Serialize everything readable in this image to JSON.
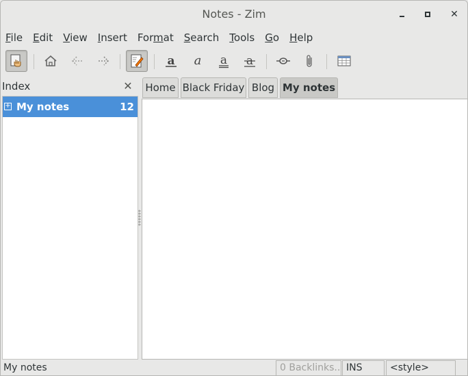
{
  "window": {
    "title": "Notes - Zim"
  },
  "menubar": {
    "items": [
      {
        "label": "File",
        "ul": "F",
        "rest": "ile"
      },
      {
        "label": "Edit",
        "ul": "E",
        "rest": "dit"
      },
      {
        "label": "View",
        "ul": "V",
        "rest": "iew"
      },
      {
        "label": "Insert",
        "ul": "I",
        "rest": "nsert"
      },
      {
        "label": "Format",
        "pre": "For",
        "ul": "m",
        "rest": "at"
      },
      {
        "label": "Search",
        "ul": "S",
        "rest": "earch"
      },
      {
        "label": "Tools",
        "ul": "T",
        "rest": "ools"
      },
      {
        "label": "Go",
        "ul": "G",
        "rest": "o"
      },
      {
        "label": "Help",
        "ul": "H",
        "rest": "elp"
      }
    ]
  },
  "toolbar": {
    "icons": [
      "read-only-toggle-icon",
      "home-icon",
      "back-icon",
      "forward-icon",
      "edit-mode-icon",
      "bold-icon",
      "italic-icon",
      "underline-icon",
      "strikethrough-icon",
      "link-icon",
      "attach-icon",
      "table-icon"
    ]
  },
  "sidebar": {
    "title": "Index",
    "items": [
      {
        "label": "My notes",
        "count": "12",
        "expander": "+"
      }
    ]
  },
  "tabs": [
    {
      "label": "Home"
    },
    {
      "label": "Black Friday"
    },
    {
      "label": "Blog"
    },
    {
      "label": "My notes",
      "active": true
    }
  ],
  "statusbar": {
    "page": "My notes",
    "backlinks": "0 Backlinks...",
    "mode": "INS",
    "style": "<style>"
  },
  "colors": {
    "selection": "#4a90d9",
    "background": "#e8e8e7"
  }
}
